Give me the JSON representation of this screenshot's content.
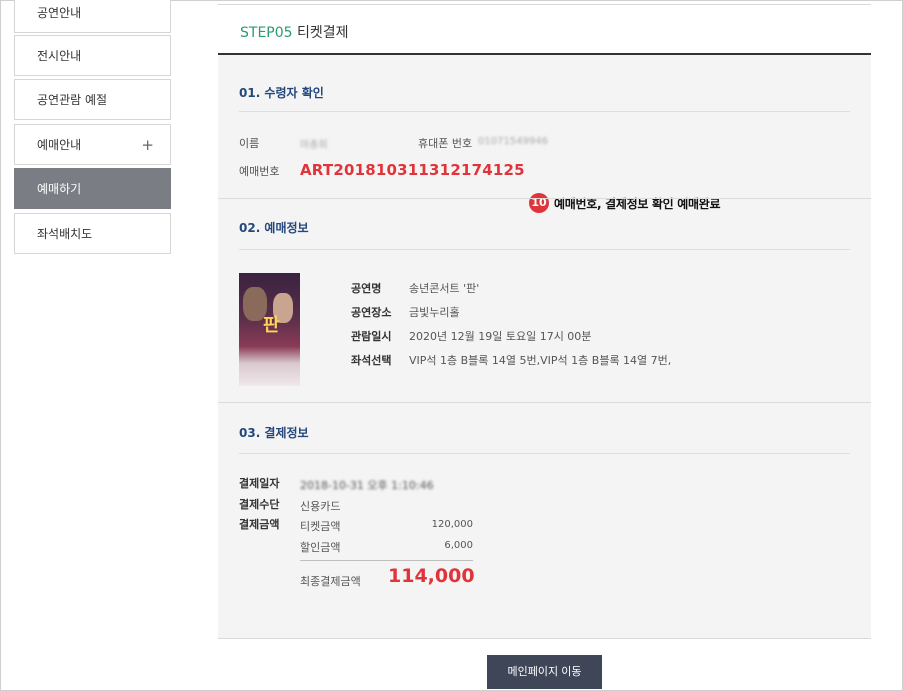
{
  "sidebar": {
    "items": [
      {
        "label": "공연안내"
      },
      {
        "label": "전시안내"
      },
      {
        "label": "공연관람 예절"
      },
      {
        "label": "예매안내",
        "expand": "+"
      },
      {
        "label": "예매하기",
        "active": true
      },
      {
        "label": "좌석배치도"
      }
    ]
  },
  "header": {
    "step": "STEP05",
    "title": "티켓결제"
  },
  "recipient": {
    "section_title": "01. 수령자 확인",
    "name_label": "이름",
    "name_value": "마총희",
    "phone_label": "휴대폰 번호",
    "phone_value": "01071549946",
    "resno_label": "예매번호",
    "resno_value": "ART201810311312174125"
  },
  "annotation": {
    "number": "10",
    "text": "예매번호, 결제정보 확인 예매완료"
  },
  "booking": {
    "section_title": "02. 예매정보",
    "rows": [
      {
        "key": "공연명",
        "value": "송년콘서트 '판'"
      },
      {
        "key": "공연장소",
        "value": "금빛누리홀"
      },
      {
        "key": "관람일시",
        "value": "2020년 12월 19일 토요일   17시 00분"
      },
      {
        "key": "좌석선택",
        "value": "VIP석 1층 B블록 14열 5번,VIP석 1층 B블록 14열 7번,"
      }
    ],
    "poster_char": "판"
  },
  "payment": {
    "section_title": "03. 결제정보",
    "date_label": "결제일자",
    "date_value": "2018-10-31 오후 1:10:46",
    "method_label": "결제수단",
    "method_value": "신용카드",
    "amount_label": "결제금액",
    "ticket_label": "티켓금액",
    "ticket_value": "120,000",
    "discount_label": "할인금액",
    "discount_value": "6,000",
    "total_label": "최종결제금액",
    "total_value": "114,000"
  },
  "button": {
    "main_label": "메인페이지 이동"
  },
  "colors": {
    "accent_red": "#e0333a",
    "step_green": "#2a9b6c",
    "section_blue": "#24487d",
    "button_dark": "#3f4657",
    "active_gray": "#7b7d85"
  }
}
